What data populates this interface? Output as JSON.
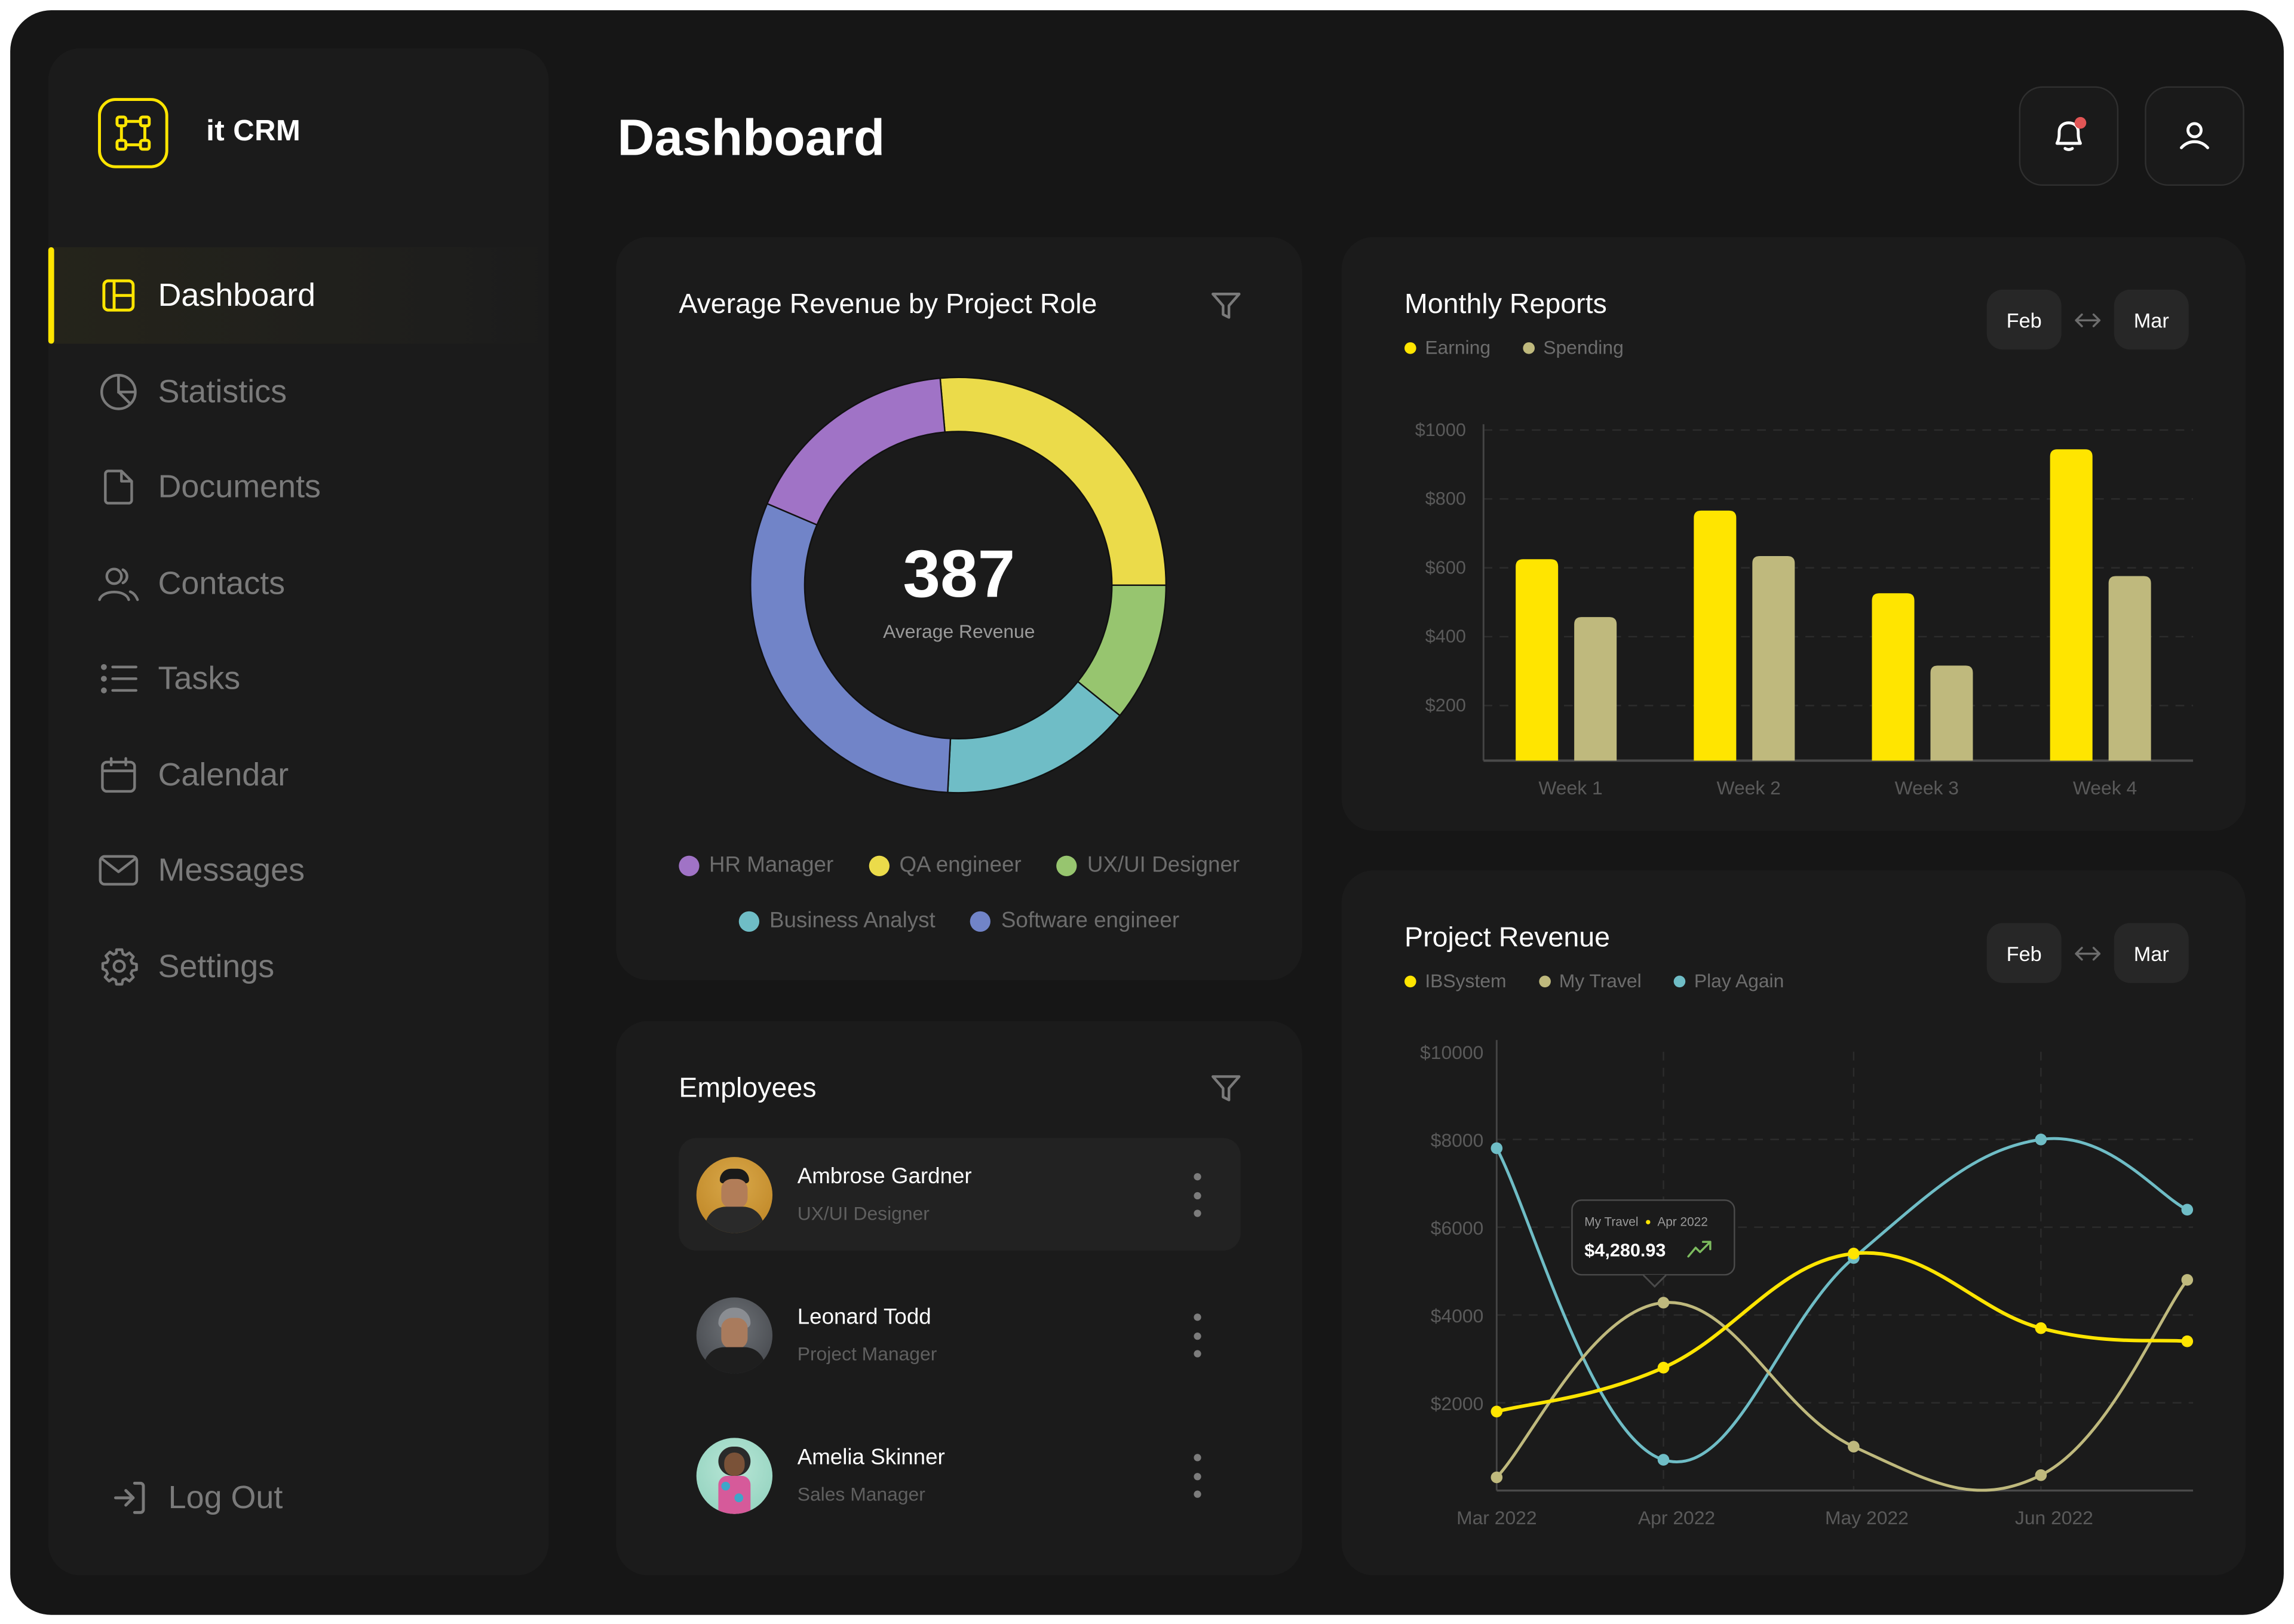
{
  "app": {
    "name": "it CRM"
  },
  "colors": {
    "accent": "#ffe500",
    "notification_dot": "#e25555",
    "trend_up": "#7dbb5f"
  },
  "sidebar": {
    "items": [
      {
        "label": "Dashboard",
        "icon": "dashboard-icon",
        "active": true
      },
      {
        "label": "Statistics",
        "icon": "pie-chart-icon",
        "active": false
      },
      {
        "label": "Documents",
        "icon": "document-icon",
        "active": false
      },
      {
        "label": "Contacts",
        "icon": "contacts-icon",
        "active": false
      },
      {
        "label": "Tasks",
        "icon": "list-icon",
        "active": false
      },
      {
        "label": "Calendar",
        "icon": "calendar-icon",
        "active": false
      },
      {
        "label": "Messages",
        "icon": "mail-icon",
        "active": false
      },
      {
        "label": "Settings",
        "icon": "gear-icon",
        "active": false
      }
    ],
    "logout_label": "Log Out"
  },
  "header": {
    "title": "Dashboard",
    "notification_icon": "bell-icon",
    "has_notification": true,
    "profile_icon": "user-icon"
  },
  "revenue_by_role": {
    "title": "Average Revenue by Project Role",
    "center_value": "387",
    "center_label": "Average Revenue"
  },
  "employees": {
    "title": "Employees",
    "list": [
      {
        "name": "Ambrose Gardner",
        "role": "UX/UI Designer",
        "highlighted": true
      },
      {
        "name": "Leonard Todd",
        "role": "Project Manager",
        "highlighted": false
      },
      {
        "name": "Amelia Skinner",
        "role": "Sales Manager",
        "highlighted": false
      }
    ]
  },
  "monthly_reports": {
    "title": "Monthly Reports",
    "range_from": "Feb",
    "range_to": "Mar"
  },
  "project_revenue": {
    "title": "Project Revenue",
    "range_from": "Feb",
    "range_to": "Mar",
    "tooltip": {
      "series": "My Travel",
      "period": "Apr 2022",
      "value": "$4,280.93",
      "trend": "up"
    }
  },
  "chart_data": [
    {
      "id": "revenue_by_role",
      "type": "pie",
      "title": "Average Revenue by Project Role",
      "donut": true,
      "start_angle_deg": -5,
      "slices": [
        {
          "label": "QA engineer",
          "value": 26.4,
          "color": "#ebdb4a"
        },
        {
          "label": "UX/UI Designer",
          "value": 10.8,
          "color": "#97c56f"
        },
        {
          "label": "Business Analyst",
          "value": 15.0,
          "color": "#6fbdc6"
        },
        {
          "label": "Software engineer",
          "value": 30.6,
          "color": "#7184c8"
        },
        {
          "label": "HR Manager",
          "value": 17.2,
          "color": "#a073c6"
        }
      ],
      "legend": [
        {
          "label": "HR Manager",
          "color": "#a073c6"
        },
        {
          "label": "QA engineer",
          "color": "#ebdb4a"
        },
        {
          "label": "UX/UI Designer",
          "color": "#97c56f"
        },
        {
          "label": "Business Analyst",
          "color": "#6fbdc6"
        },
        {
          "label": "Software engineer",
          "color": "#7184c8"
        }
      ],
      "legend_rows": [
        [
          0,
          1,
          2
        ],
        [
          3,
          4
        ]
      ],
      "legend_position": "bottom"
    },
    {
      "id": "monthly_reports",
      "type": "bar",
      "title": "Monthly Reports",
      "categories": [
        "Week 1",
        "Week 2",
        "Week 3",
        "Week 4"
      ],
      "series": [
        {
          "name": "Earning",
          "color": "#ffe500",
          "values": [
            625,
            766,
            526,
            944
          ]
        },
        {
          "name": "Spending",
          "color": "#bfb97d",
          "values": [
            457,
            634,
            316,
            576
          ]
        }
      ],
      "yticks": [
        200,
        400,
        600,
        800,
        1000
      ],
      "ytick_labels": [
        "$200",
        "$400",
        "$600",
        "$800",
        "$1000"
      ],
      "ylim": [
        40,
        1000
      ],
      "grid": true,
      "legend_position": "top-left"
    },
    {
      "id": "project_revenue",
      "type": "line",
      "title": "Project Revenue",
      "x": [
        "Mar 2022",
        "Apr 2022",
        "May 2022",
        "Jun 2022",
        ""
      ],
      "xtick_labels": [
        "Mar 2022",
        "Apr 2022",
        "May 2022",
        "Jun 2022"
      ],
      "series": [
        {
          "name": "IBSystem",
          "color": "#ffe500",
          "values": [
            1800,
            2800,
            5400,
            3700,
            3400
          ]
        },
        {
          "name": "My Travel",
          "color": "#bfb97d",
          "values": [
            300,
            4281,
            1000,
            350,
            4800
          ]
        },
        {
          "name": "Play Again",
          "color": "#6fbdc6",
          "values": [
            7800,
            700,
            5300,
            8000,
            6400
          ]
        }
      ],
      "yticks": [
        2000,
        4000,
        6000,
        8000,
        10000
      ],
      "ytick_labels": [
        "$2000",
        "$4000",
        "$6000",
        "$8000",
        "$10000"
      ],
      "ylim": [
        0,
        10000
      ],
      "grid": true,
      "smooth": true,
      "legend_position": "top-left"
    }
  ]
}
